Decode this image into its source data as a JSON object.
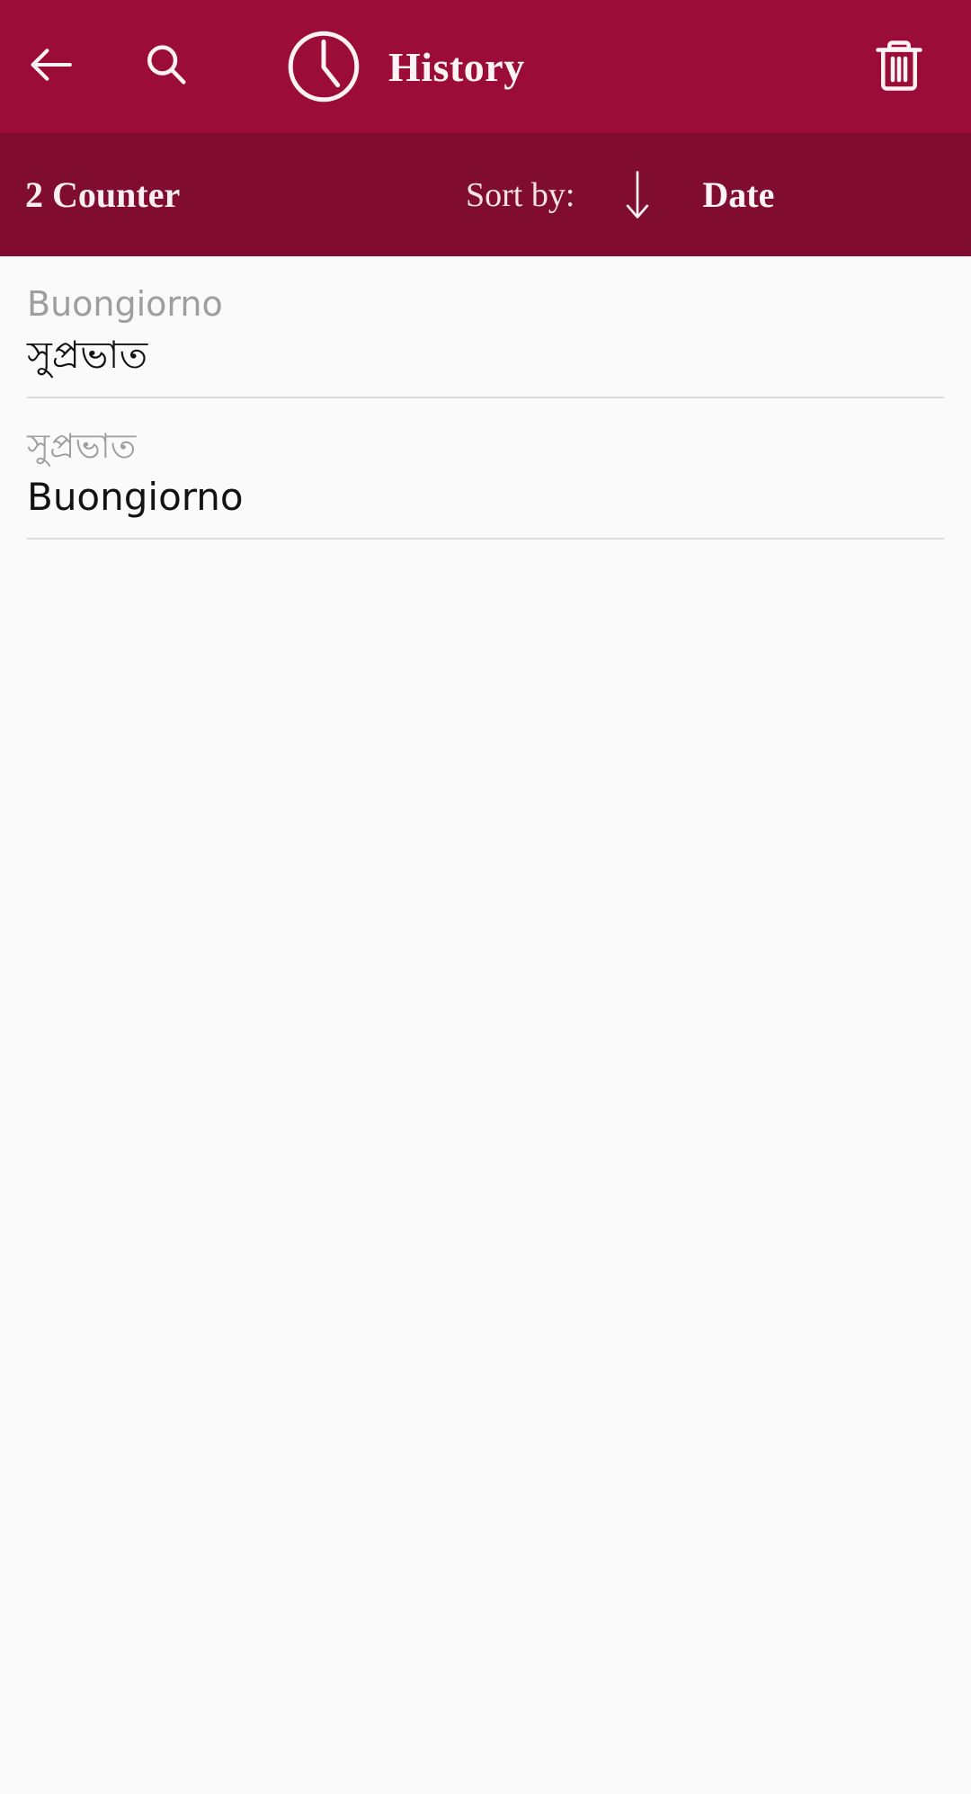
{
  "theme": {
    "appbar_color": "#9b0d38",
    "subbar_color": "#800c30",
    "body_color": "#fafafa",
    "on_primary_color": "#fdf2f5",
    "muted_text_color": "#9e9e9e",
    "primary_text_color": "#121212",
    "divider_color": "#dcdcdc"
  },
  "appbar": {
    "back_icon": "arrow-left-icon",
    "search_icon": "search-icon",
    "clock_icon": "clock-icon",
    "title": "History",
    "delete_icon": "trash-icon"
  },
  "subbar": {
    "counter_label": "2 Counter",
    "sort_by_label": "Sort by:",
    "sort_direction_icon": "arrow-down-icon",
    "sort_value": "Date",
    "dropdown_icon": "caret-down-icon"
  },
  "history": {
    "items": [
      {
        "source_text": "Buongiorno",
        "target_text": "সুপ্রভাত"
      },
      {
        "source_text": "সুপ্রভাত",
        "target_text": "Buongiorno"
      }
    ]
  }
}
